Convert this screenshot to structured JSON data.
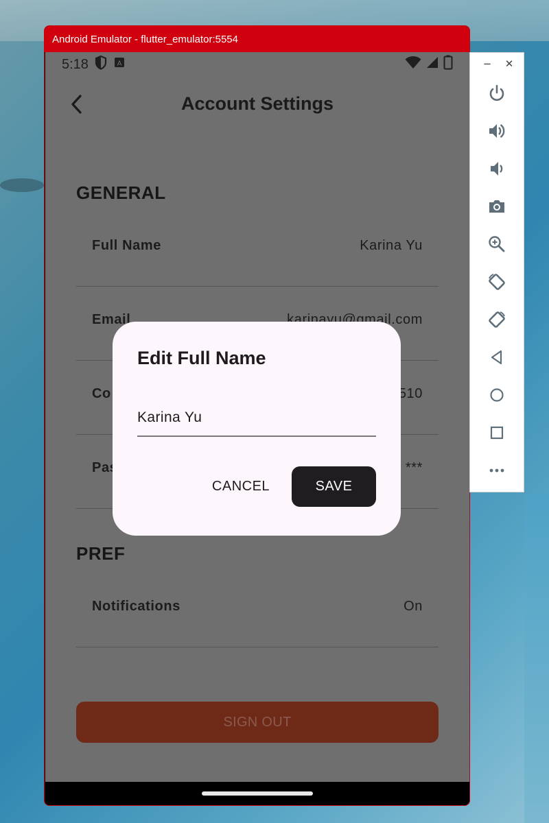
{
  "window": {
    "title": "Android Emulator - flutter_emulator:5554"
  },
  "status_bar": {
    "time": "5:18"
  },
  "app_bar": {
    "title": "Account Settings"
  },
  "sections": {
    "general": "GENERAL",
    "preferences_visible": "PREF"
  },
  "settings": [
    {
      "label": "Full Name",
      "value": "Karina Yu"
    },
    {
      "label": "Email",
      "value": "karinayu@gmail.com"
    },
    {
      "label": "Co",
      "value": "510"
    },
    {
      "label": "Pas",
      "value": "***"
    },
    {
      "label": "Notifications",
      "value": "On"
    }
  ],
  "sign_out": {
    "label": "SIGN OUT"
  },
  "dialog": {
    "title": "Edit Full Name",
    "input_value": "Karina Yu",
    "cancel_label": "CANCEL",
    "save_label": "SAVE"
  },
  "toolbar": {
    "minimize": "−",
    "close": "✕",
    "buttons": [
      "power-icon",
      "volume-up-icon",
      "volume-down-icon",
      "camera-icon",
      "zoom-icon",
      "rotate-left-icon",
      "rotate-right-icon",
      "back-icon",
      "home-icon",
      "overview-icon",
      "more-icon"
    ]
  },
  "colors": {
    "titlebar": "#d0000e",
    "scrim_bg": "#6f6f70",
    "dialog_bg": "#fdf6fc",
    "save_bg": "#1f1d1f",
    "signout_bg": "#6e2a17"
  }
}
